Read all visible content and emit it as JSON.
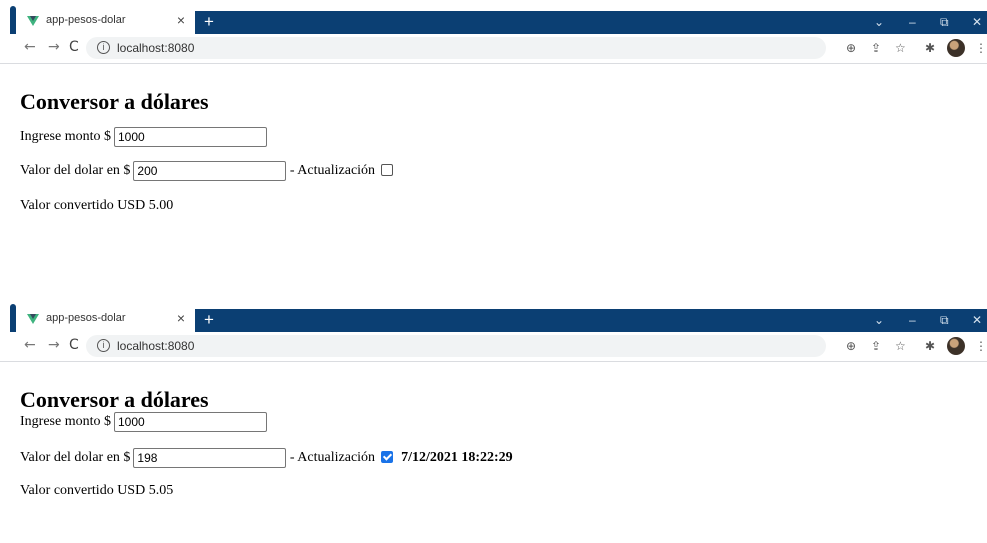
{
  "screenshots": [
    {
      "browser": {
        "tab_title": "app-pesos-dolar",
        "tab_close": "×",
        "new_tab": "+",
        "win_controls": [
          "⌄",
          "–",
          "⧉",
          "✕"
        ],
        "url": "localhost:8080"
      },
      "page": {
        "heading": "Conversor a dólares",
        "amount_label": "Ingrese monto $",
        "amount_value": "1000",
        "rate_label": "Valor del dolar en $",
        "rate_value": "200",
        "update_label": "- Actualización",
        "update_checked": false,
        "timestamp": "",
        "result_text": "Valor convertido USD 5.00"
      }
    },
    {
      "browser": {
        "tab_title": "app-pesos-dolar",
        "tab_close": "×",
        "new_tab": "+",
        "win_controls": [
          "⌄",
          "–",
          "⧉",
          "✕"
        ],
        "url": "localhost:8080"
      },
      "page": {
        "heading": "Conversor a dólares",
        "amount_label": "Ingrese monto $",
        "amount_value": "1000",
        "rate_label": "Valor del dolar en $",
        "rate_value": "198",
        "update_label": "- Actualización",
        "update_checked": true,
        "timestamp": "7/12/2021 18:22:29",
        "result_text": "Valor convertido USD 5.05"
      }
    }
  ],
  "icons": {
    "back": "back-arrow-icon",
    "forward": "forward-arrow-icon",
    "reload": "reload-icon",
    "info": "info-icon",
    "zoom": "zoom-icon",
    "share": "share-icon",
    "star": "bookmark-star-icon",
    "extensions": "extensions-puzzle-icon",
    "menu": "kebab-menu-icon"
  },
  "colors": {
    "tabstrip": "#0b3f73",
    "checkbox_checked": "#1a73e8",
    "vue_green": "#3fb37f"
  }
}
